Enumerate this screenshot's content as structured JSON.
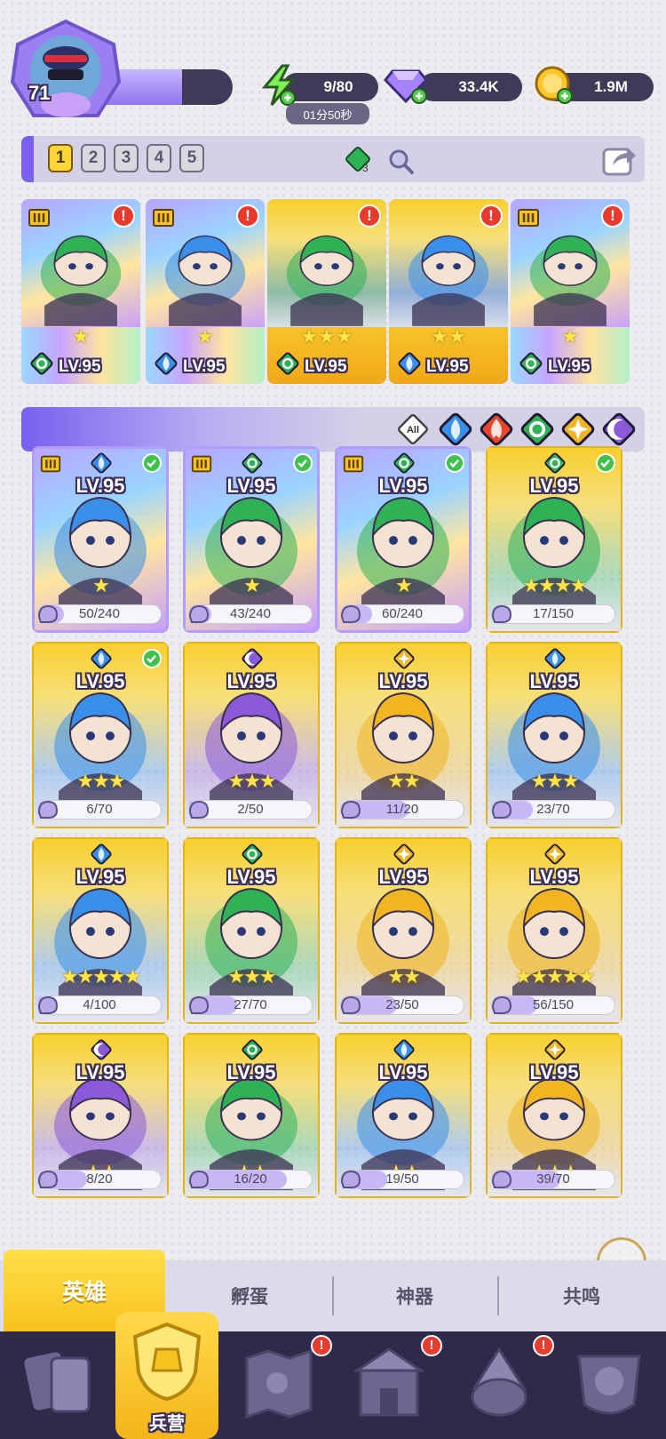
{
  "player": {
    "level": "71",
    "xp_fraction": 0.6
  },
  "resources": {
    "energy": "9/80",
    "energy_timer": "01分50秒",
    "gems": "33.4K",
    "coins": "1.9M"
  },
  "team": {
    "slots": [
      "1",
      "2",
      "3",
      "4",
      "5"
    ],
    "active_slot": "1",
    "gem_count": "3"
  },
  "team_cards": [
    {
      "level": "LV.95",
      "element": "nature",
      "stars": "★",
      "rank": true,
      "alert": "!",
      "rarity": "rainbow"
    },
    {
      "level": "LV.95",
      "element": "water",
      "stars": "★",
      "rank": true,
      "alert": "!",
      "rarity": "rainbow"
    },
    {
      "level": "LV.95",
      "element": "nature",
      "stars": "★★★",
      "rank": false,
      "alert": "!",
      "rarity": "gold"
    },
    {
      "level": "LV.95",
      "element": "water",
      "stars": "★★",
      "rank": false,
      "alert": "!",
      "rarity": "gold"
    },
    {
      "level": "LV.95",
      "element": "nature",
      "stars": "★",
      "rank": true,
      "alert": "!",
      "rarity": "rainbow"
    }
  ],
  "filters": {
    "all_label": "All",
    "elements": [
      "water",
      "fire",
      "nature",
      "light",
      "dark"
    ]
  },
  "heroes": [
    {
      "level": "LV.95",
      "element": "water",
      "progress": "50/240",
      "frac": 0.21,
      "stars": "★",
      "check": true,
      "rank": true,
      "rarity": "rainbow"
    },
    {
      "level": "LV.95",
      "element": "nature",
      "progress": "43/240",
      "frac": 0.18,
      "stars": "★",
      "check": true,
      "rank": true,
      "rarity": "rainbow"
    },
    {
      "level": "LV.95",
      "element": "nature",
      "progress": "60/240",
      "frac": 0.25,
      "stars": "★",
      "check": true,
      "rank": true,
      "rarity": "rainbow"
    },
    {
      "level": "LV.95",
      "element": "nature",
      "progress": "17/150",
      "frac": 0.11,
      "stars": "★★★★",
      "check": true,
      "rank": false,
      "rarity": "gold"
    },
    {
      "level": "LV.95",
      "element": "water",
      "progress": "6/70",
      "frac": 0.09,
      "stars": "★★★",
      "check": true,
      "rank": false,
      "rarity": "gold"
    },
    {
      "level": "LV.95",
      "element": "dark",
      "progress": "2/50",
      "frac": 0.04,
      "stars": "★★★",
      "check": false,
      "rank": false,
      "rarity": "gold"
    },
    {
      "level": "LV.95",
      "element": "light",
      "progress": "11/20",
      "frac": 0.55,
      "stars": "★★",
      "check": false,
      "rank": false,
      "rarity": "gold"
    },
    {
      "level": "LV.95",
      "element": "water",
      "progress": "23/70",
      "frac": 0.33,
      "stars": "★★★",
      "check": false,
      "rank": false,
      "rarity": "gold"
    },
    {
      "level": "LV.95",
      "element": "water",
      "progress": "4/100",
      "frac": 0.04,
      "stars": "★★★★★",
      "check": false,
      "rank": false,
      "rarity": "gold"
    },
    {
      "level": "LV.95",
      "element": "nature",
      "progress": "27/70",
      "frac": 0.39,
      "stars": "★★★",
      "check": false,
      "rank": false,
      "rarity": "gold"
    },
    {
      "level": "LV.95",
      "element": "light",
      "progress": "23/50",
      "frac": 0.46,
      "stars": "★★",
      "check": false,
      "rank": false,
      "rarity": "gold"
    },
    {
      "level": "LV.95",
      "element": "light",
      "progress": "56/150",
      "frac": 0.37,
      "stars": "★★★★★",
      "check": false,
      "rank": false,
      "rarity": "gold"
    },
    {
      "level": "LV.95",
      "element": "dark",
      "progress": "8/20",
      "frac": 0.4,
      "stars": "★★",
      "check": false,
      "rank": false,
      "rarity": "gold"
    },
    {
      "level": "LV.95",
      "element": "nature",
      "progress": "16/20",
      "frac": 0.8,
      "stars": "★★",
      "check": false,
      "rank": false,
      "rarity": "gold"
    },
    {
      "level": "LV.95",
      "element": "water",
      "progress": "19/50",
      "frac": 0.38,
      "stars": "★★",
      "check": false,
      "rank": false,
      "rarity": "gold"
    },
    {
      "level": "LV.95",
      "element": "light",
      "progress": "39/70",
      "frac": 0.56,
      "stars": "★★★",
      "check": false,
      "rank": false,
      "rarity": "gold"
    }
  ],
  "tabs": {
    "hero": "英雄",
    "hatch": "孵蛋",
    "artifact": "神器",
    "resonance": "共鸣"
  },
  "nav": {
    "barracks": "兵营",
    "alert": "!"
  },
  "colors": {
    "water": "#3a8fe8",
    "fire": "#e8452a",
    "nature": "#2fb255",
    "light": "#f0b520",
    "dark": "#8a5ad8",
    "accent": "#7a60f0",
    "gold": "#f7c21c"
  }
}
